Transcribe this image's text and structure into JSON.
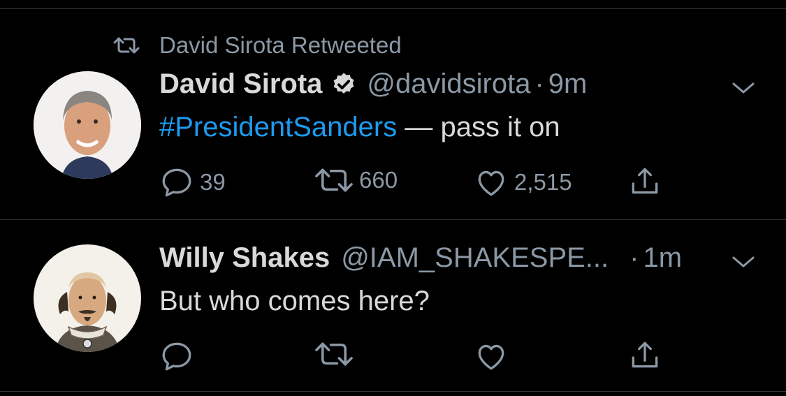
{
  "tweets": [
    {
      "retweet_label": "David Sirota Retweeted",
      "name": "David Sirota",
      "verified": true,
      "handle": "@davidsirota",
      "sep": "·",
      "time": "9m",
      "hashtag": "#PresidentSanders",
      "text_rest": " — pass it on",
      "replies": "39",
      "retweets": "660",
      "likes": "2,515"
    },
    {
      "name": "Willy Shakes",
      "handle": "@IAM_SHAKESPE...",
      "sep": "·",
      "time": "1m",
      "text": "But who comes here?"
    }
  ],
  "icons": [
    "retweet-icon",
    "verified-badge-icon",
    "chevron-down-icon",
    "reply-icon",
    "like-icon",
    "share-icon"
  ],
  "colors": {
    "background": "#000000",
    "text": "#d9d9d9",
    "secondary": "#8b98a5",
    "link": "#1d9bf0",
    "divider": "#2f3336"
  }
}
